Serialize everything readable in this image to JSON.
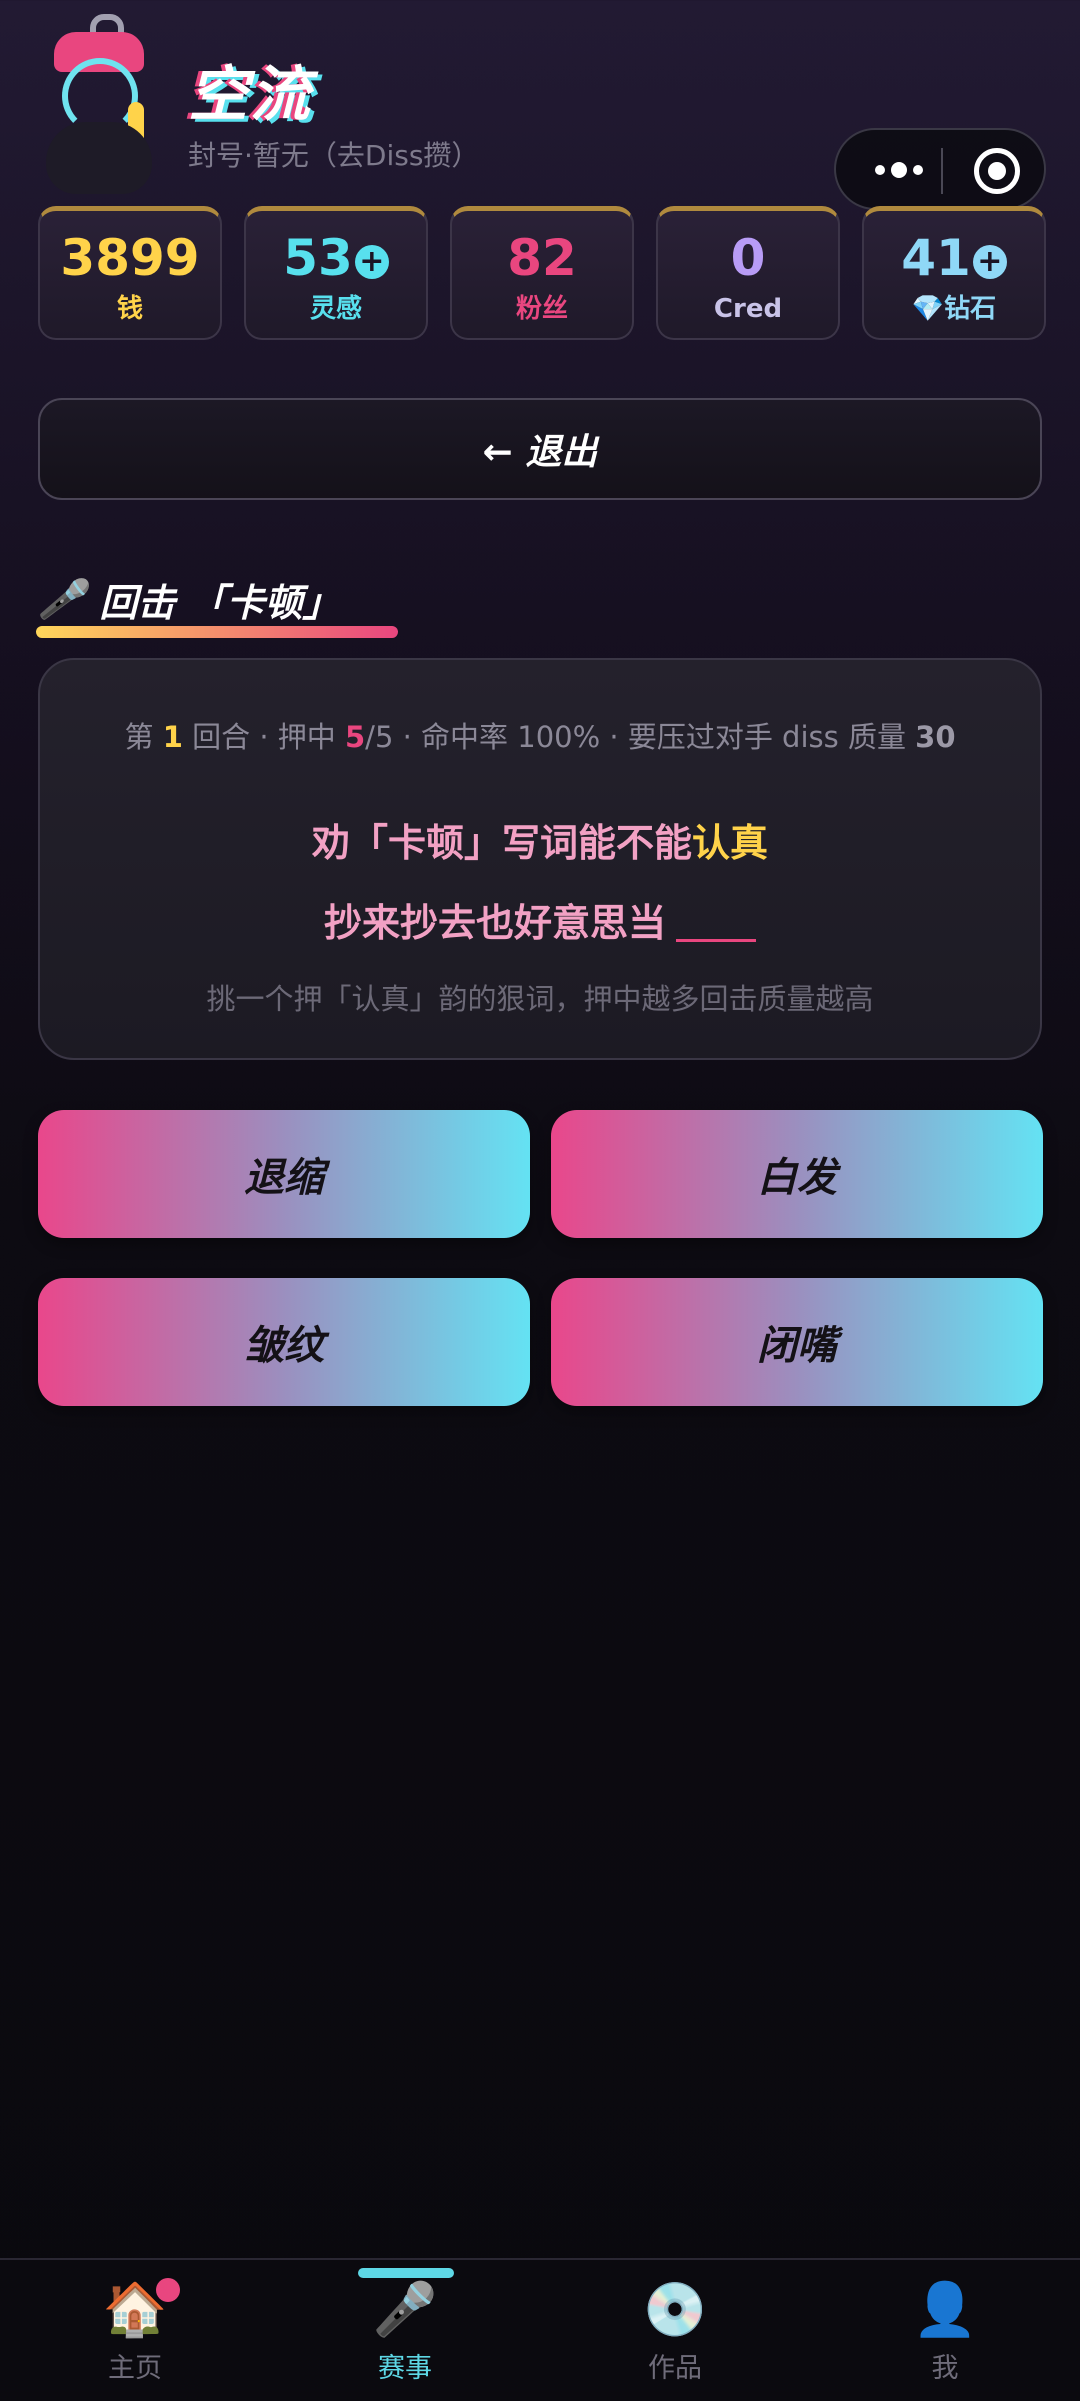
{
  "header": {
    "username": "空流",
    "subtitle": "封号·暂无（去Diss攒）"
  },
  "stats": [
    {
      "value": "3899",
      "label": "钱",
      "color": "#ffd34a",
      "plus": false
    },
    {
      "value": "53",
      "label": "灵感",
      "color": "#58e0ee",
      "plus": true
    },
    {
      "value": "82",
      "label": "粉丝",
      "color": "#e9467f",
      "plus": false
    },
    {
      "value": "0",
      "label": "Cred",
      "color": "#b89cf6",
      "plus": false
    },
    {
      "value": "41",
      "label": "💎钻石",
      "color": "#8fd8f7",
      "plus": true
    }
  ],
  "exit_label": "← 退出",
  "section": {
    "icon": "🎤",
    "title": "回击 「卡顿」"
  },
  "question": {
    "round_prefix": "第",
    "round": "1",
    "round_suffix": "回合 · 押中",
    "hits": "5",
    "hits_total": "/5 · 命中率 100% · 要压过对手 diss 质量",
    "target_quality": "30",
    "line1_text": "劝「卡顿」写词能不能",
    "line1_highlight": "认真",
    "line2_text": "抄来抄去也好意思当",
    "hint": "挑一个押「认真」韵的狠词，押中越多回击质量越高"
  },
  "answers": [
    "退缩",
    "白发",
    "皱纹",
    "闭嘴"
  ],
  "nav": [
    {
      "icon": "🏠",
      "label": "主页",
      "name": "home",
      "badge": true,
      "active": false
    },
    {
      "icon": "🎤",
      "label": "赛事",
      "name": "match",
      "badge": false,
      "active": true
    },
    {
      "icon": "💿",
      "label": "作品",
      "name": "works",
      "badge": false,
      "active": false
    },
    {
      "icon": "👤",
      "label": "我",
      "name": "me",
      "badge": false,
      "active": false
    }
  ]
}
